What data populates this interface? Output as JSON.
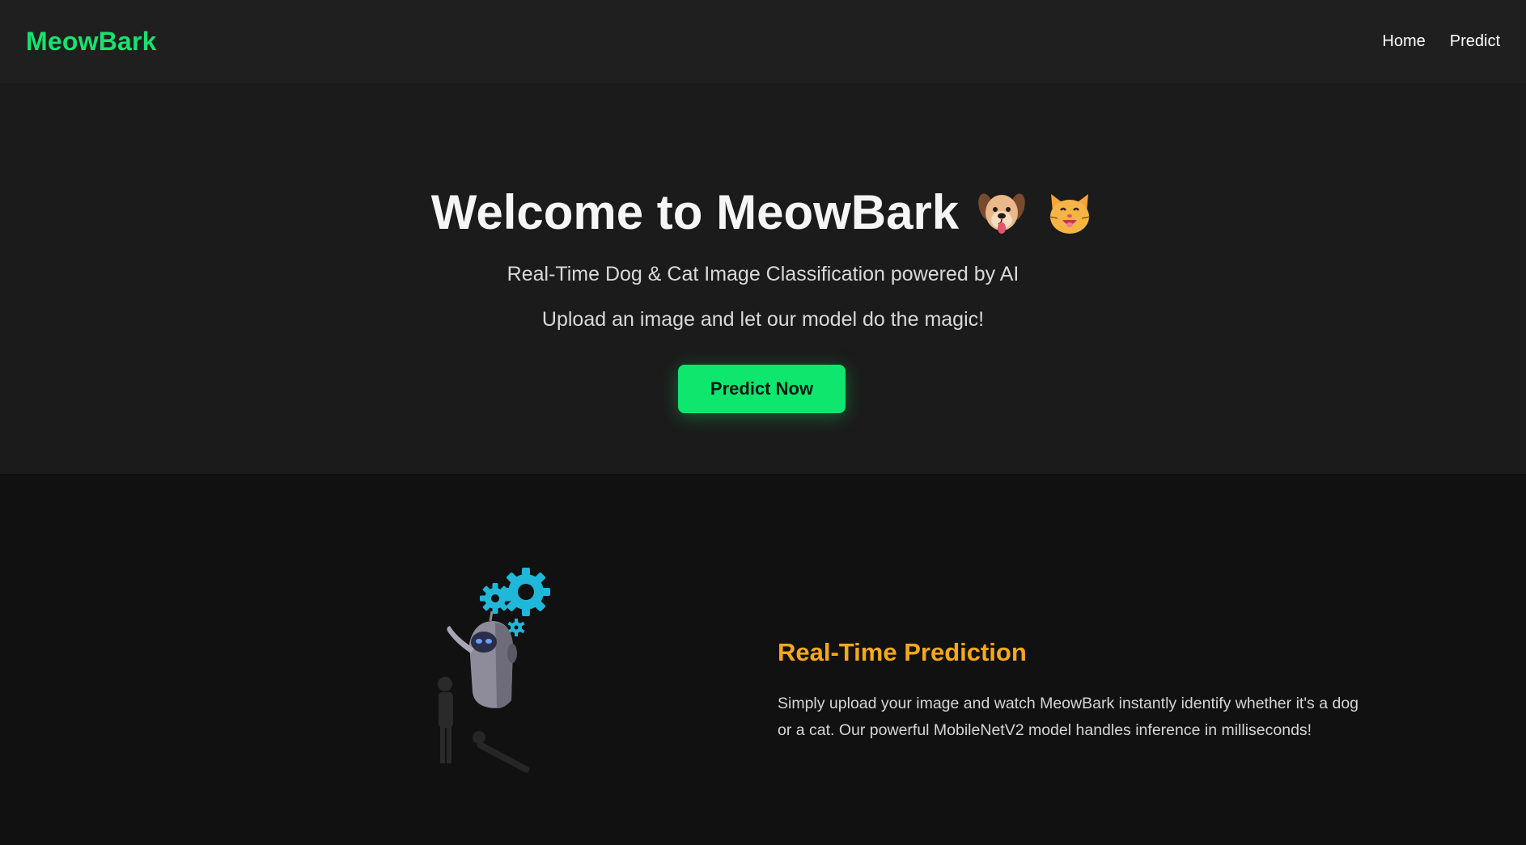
{
  "navbar": {
    "brand": "MeowBark",
    "links": [
      {
        "label": "Home"
      },
      {
        "label": "Predict"
      }
    ]
  },
  "hero": {
    "title": "Welcome to MeowBark",
    "emojis": [
      "dog-face-icon",
      "cat-face-icon"
    ],
    "subtitle": "Real-Time Dog & Cat Image Classification powered by AI",
    "tagline": "Upload an image and let our model do the magic!",
    "cta_label": "Predict Now"
  },
  "feature": {
    "illustration": "robot-gears-illustration",
    "title": "Real-Time Prediction",
    "text": "Simply upload your image and watch MeowBark instantly identify whether it's a dog or a cat. Our powerful MobileNetV2 model handles inference in milliseconds!"
  },
  "colors": {
    "brand": "#17e36e",
    "cta": "#0ee66e",
    "feature_title": "#f5a81c",
    "gear": "#1fb8d8"
  }
}
